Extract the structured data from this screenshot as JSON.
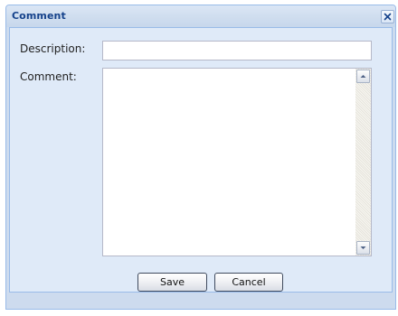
{
  "dialog": {
    "title": "Comment",
    "close_icon": "close-icon"
  },
  "form": {
    "description_label": "Description:",
    "description_value": "",
    "comment_label": "Comment:",
    "comment_value": "",
    "scroll_up_icon": "arrow-up-icon",
    "scroll_down_icon": "arrow-down-icon"
  },
  "buttons": {
    "save_label": "Save",
    "cancel_label": "Cancel"
  }
}
